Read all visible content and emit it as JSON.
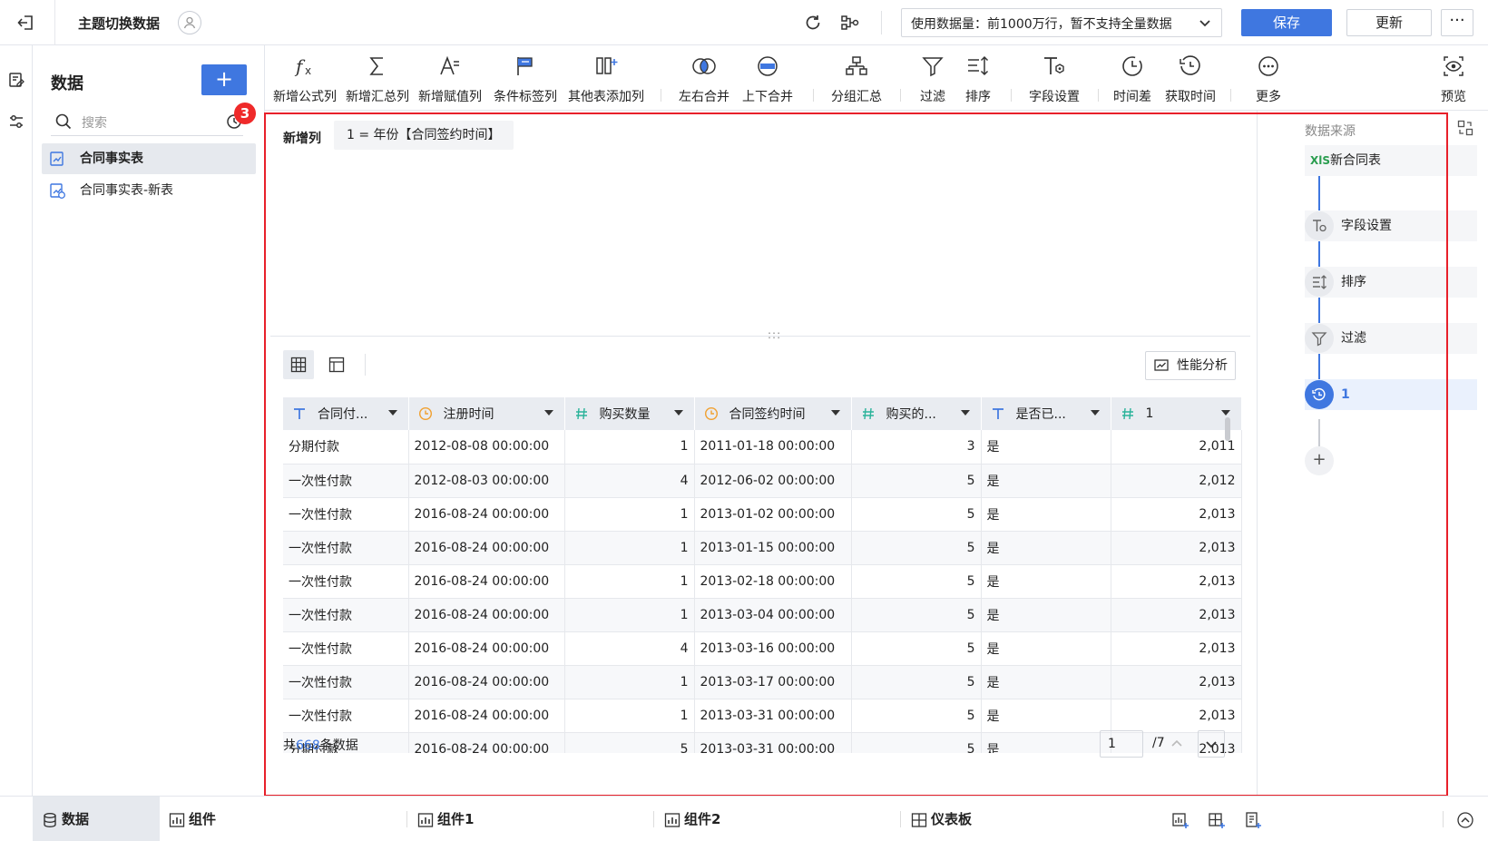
{
  "header": {
    "title": "主题切换数据",
    "data_scope": "使用数据量：前1000万行，暂不支持全量数据",
    "save_label": "保存",
    "update_label": "更新",
    "more_label": "···"
  },
  "panel": {
    "title": "数据",
    "add_label": "+",
    "search_placeholder": "搜索",
    "history_badge": "3",
    "items": [
      {
        "label": "合同事实表",
        "active": true
      },
      {
        "label": "合同事实表-新表",
        "active": false
      }
    ]
  },
  "toolbar": {
    "items": [
      "新增公式列",
      "新增汇总列",
      "新增赋值列",
      "条件标签列",
      "其他表添加列",
      "左右合并",
      "上下合并",
      "分组汇总",
      "过滤",
      "排序",
      "字段设置",
      "时间差",
      "获取时间",
      "更多",
      "预览"
    ]
  },
  "editor": {
    "label": "新增列",
    "expression": "1 = 年份【合同签约时间】",
    "handle": ":::",
    "perf_label": "性能分析"
  },
  "table": {
    "columns": [
      "合同付...",
      "注册时间",
      "购买数量",
      "合同签约时间",
      "购买的...",
      "是否已...",
      "1"
    ],
    "rows": [
      [
        "分期付款",
        "2012-08-08 00:00:00",
        "1",
        "2011-01-18 00:00:00",
        "3",
        "是",
        "2,011"
      ],
      [
        "一次性付款",
        "2012-08-03 00:00:00",
        "4",
        "2012-06-02 00:00:00",
        "5",
        "是",
        "2,012"
      ],
      [
        "一次性付款",
        "2016-08-24 00:00:00",
        "1",
        "2013-01-02 00:00:00",
        "5",
        "是",
        "2,013"
      ],
      [
        "一次性付款",
        "2016-08-24 00:00:00",
        "1",
        "2013-01-15 00:00:00",
        "5",
        "是",
        "2,013"
      ],
      [
        "一次性付款",
        "2016-08-24 00:00:00",
        "1",
        "2013-02-18 00:00:00",
        "5",
        "是",
        "2,013"
      ],
      [
        "一次性付款",
        "2016-08-24 00:00:00",
        "1",
        "2013-03-04 00:00:00",
        "5",
        "是",
        "2,013"
      ],
      [
        "一次性付款",
        "2016-08-24 00:00:00",
        "4",
        "2013-03-16 00:00:00",
        "5",
        "是",
        "2,013"
      ],
      [
        "一次性付款",
        "2016-08-24 00:00:00",
        "1",
        "2013-03-17 00:00:00",
        "5",
        "是",
        "2,013"
      ],
      [
        "一次性付款",
        "2016-08-24 00:00:00",
        "1",
        "2013-03-31 00:00:00",
        "5",
        "是",
        "2,013"
      ],
      [
        "分期付款",
        "2016-08-24 00:00:00",
        "5",
        "2013-03-31 00:00:00",
        "5",
        "是",
        "2,013"
      ]
    ]
  },
  "footer": {
    "prefix": "共",
    "count": "668",
    "suffix": "条数据",
    "page": "1",
    "total_pages": "/7"
  },
  "side": {
    "title": "数据来源",
    "source": "新合同表",
    "source_badge": "XlS",
    "steps": [
      "字段设置",
      "排序",
      "过滤",
      "1"
    ],
    "plus": "+"
  },
  "bottom": {
    "tabs": [
      "数据",
      "组件",
      "组件1",
      "组件2",
      "仪表板"
    ]
  },
  "colors": {
    "accent": "#3f77e0",
    "highlight": "#e8202a",
    "badge": "#ef2a2a"
  }
}
